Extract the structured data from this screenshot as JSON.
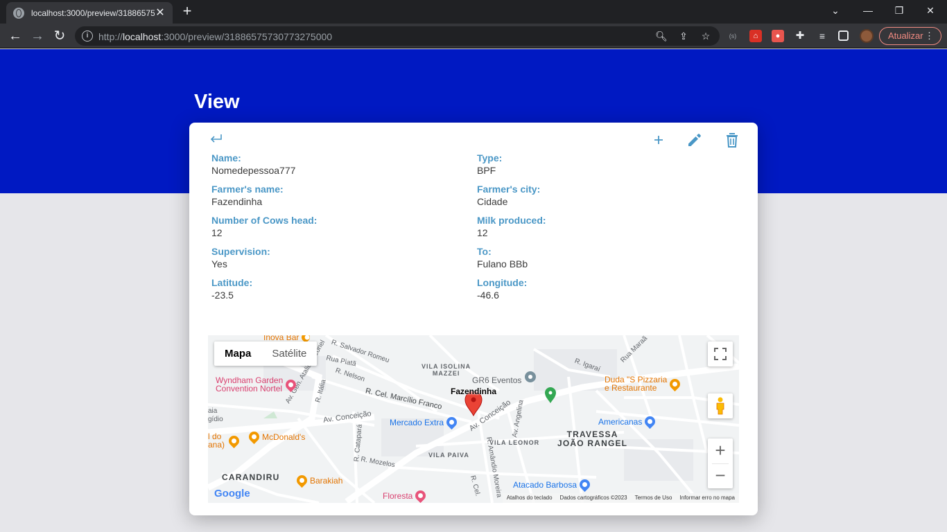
{
  "browser": {
    "tab_title": "localhost:3000/preview/3188657573...",
    "tab_close": "✕",
    "new_tab": "+",
    "url_host": "localhost",
    "url_prefix": "http://",
    "url_rest": ":3000/preview/31886575730773275000",
    "update_label": "Atualizar"
  },
  "page": {
    "title": "View"
  },
  "fields": [
    {
      "label": "Name:",
      "value": "Nomedepessoa777"
    },
    {
      "label": "Type:",
      "value": "BPF"
    },
    {
      "label": "Farmer's name:",
      "value": "Fazendinha"
    },
    {
      "label": "Farmer's city:",
      "value": "Cidade"
    },
    {
      "label": "Number of Cows head:",
      "value": "12"
    },
    {
      "label": "Milk produced:",
      "value": "12"
    },
    {
      "label": "Supervision:",
      "value": "Yes"
    },
    {
      "label": "To:",
      "value": "Fulano BBb"
    },
    {
      "label": "Latitude:",
      "value": "-23.5"
    },
    {
      "label": "Longitude:",
      "value": "-46.6"
    }
  ],
  "map": {
    "type_map": "Mapa",
    "type_satellite": "Satélite",
    "marker_label": "Fazendinha",
    "zoom_in": "+",
    "zoom_out": "−",
    "logo": "Google",
    "footer": [
      "Atalhos do teclado",
      "Dados cartográficos ©2023",
      "Termos de Uso",
      "Informar erro no mapa"
    ],
    "places": {
      "inova": "Inova Bar",
      "wyndham_1": "Wyndham Garden",
      "wyndham_2": "Convention Nortel",
      "gr6": "GR6 Eventos",
      "duda_1": "Duda \"S Pizzaria",
      "duda_2": "e Restaurante",
      "mercado": "Mercado Extra",
      "americanas": "Americanas",
      "mcdonalds": "McDonald's",
      "barakiah": "Barakiah",
      "atacado": "Atacado Barbosa",
      "floresta": "Floresta",
      "ido": "l do",
      "ana": "ana)"
    },
    "streets": {
      "salvador": "R. Salvador Romeu",
      "piata": "Rua Piatã",
      "nelson": "R. Nelson",
      "italia": "R. Itália",
      "atalibaleone": "Av. Gen. Ataliba Leonel",
      "marcilio": "R. Cel. Marcílio Franco",
      "conceicao1": "Av. Conceição",
      "conceicao2": "Av. Conceição",
      "catapara": "R. Catapará",
      "mozelos": "R. Mozelos",
      "amandio": "R. Amândio Moreira",
      "angelina": "Av. Angelina",
      "igarai": "R. Igaraí",
      "marai": "Rua Maraã",
      "cel": "R. Cel.",
      "gidio": "gídio",
      "aia": "aia"
    },
    "areas": {
      "vila_isolina_1": "VILA ISOLINA",
      "vila_isolina_2": "MAZZEI",
      "travessa_1": "TRAVESSA",
      "travessa_2": "JOÃO RANGEL",
      "vila_leonor": "VILA LEONOR",
      "vila_paiva": "VILA PAIVA",
      "carandiru": "CARANDIRU"
    }
  }
}
